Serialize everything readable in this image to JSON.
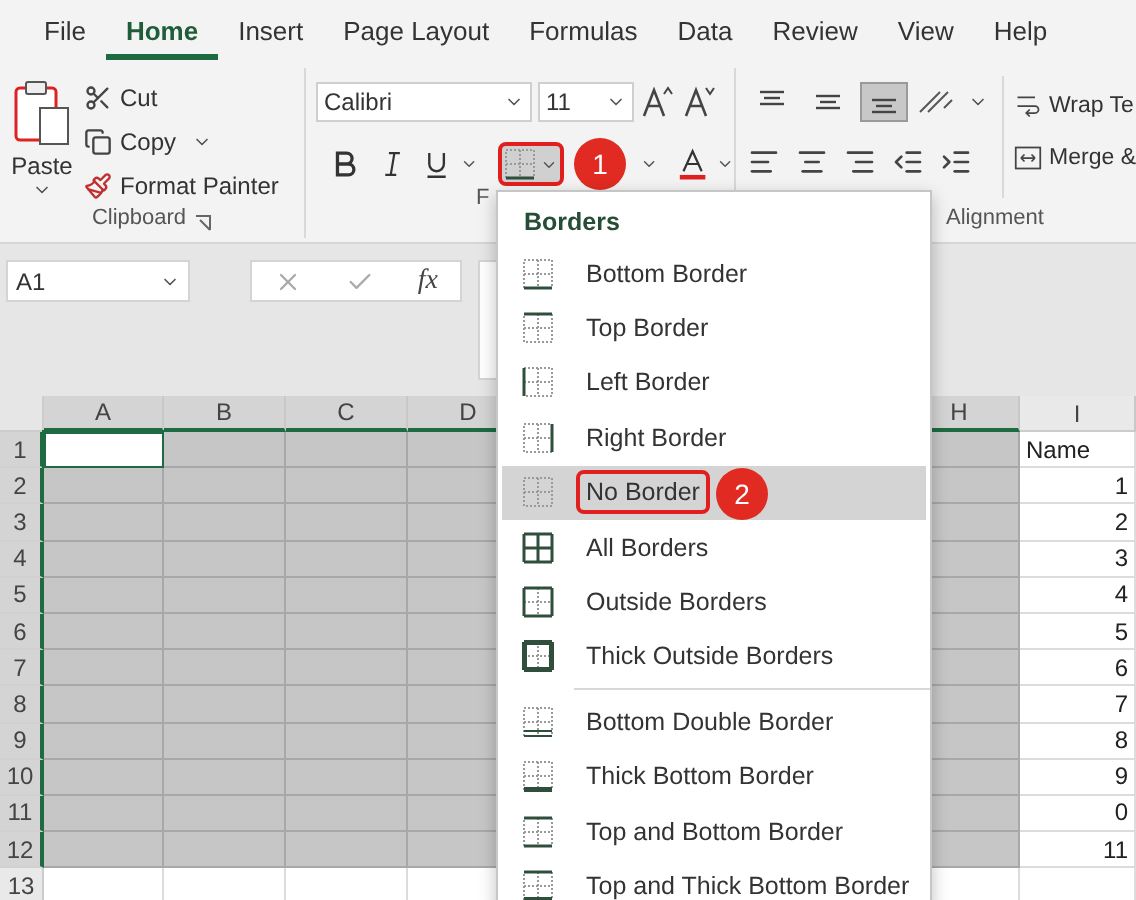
{
  "ribbon_tabs": [
    {
      "label": "File",
      "selected": false
    },
    {
      "label": "Home",
      "selected": true
    },
    {
      "label": "Insert",
      "selected": false
    },
    {
      "label": "Page Layout",
      "selected": false
    },
    {
      "label": "Formulas",
      "selected": false
    },
    {
      "label": "Data",
      "selected": false
    },
    {
      "label": "Review",
      "selected": false
    },
    {
      "label": "View",
      "selected": false
    },
    {
      "label": "Help",
      "selected": false
    }
  ],
  "clipboard": {
    "paste": "Paste",
    "group_label": "Clipboard",
    "commands": [
      {
        "kind": "cut",
        "label": "Cut"
      },
      {
        "kind": "copy",
        "label": "Copy"
      },
      {
        "kind": "format_painter",
        "label": "Format Painter"
      }
    ]
  },
  "font": {
    "font_name": "Calibri",
    "font_size": "11",
    "group_label": "F",
    "borders_button": {
      "outlined": true,
      "callout": "1"
    }
  },
  "alignment": {
    "group_label": "Alignment",
    "wrap_text": "Wrap Te",
    "merge": "Merge &",
    "vertical": [
      {
        "kind": "top",
        "selected": false
      },
      {
        "kind": "middle",
        "selected": false
      },
      {
        "kind": "bottom",
        "selected": true
      }
    ]
  },
  "formula_bar": {
    "name_box": "A1",
    "function_symbol": "fx"
  },
  "sheet": {
    "columns": [
      {
        "label": "A",
        "selected": true
      },
      {
        "label": "B",
        "selected": true
      },
      {
        "label": "C",
        "selected": true
      },
      {
        "label": "D",
        "selected": true
      },
      {
        "label": "H",
        "selected": true
      },
      {
        "label": "I",
        "selected": false
      }
    ],
    "rows": [
      {
        "header": "1",
        "selected": true,
        "active_cell": true,
        "column_i": {
          "text": "Name",
          "kind": "text"
        }
      },
      {
        "header": "2",
        "selected": true,
        "active_cell": false,
        "column_i": {
          "text": "1",
          "kind": "number"
        }
      },
      {
        "header": "3",
        "selected": true,
        "active_cell": false,
        "column_i": {
          "text": "2",
          "kind": "number"
        }
      },
      {
        "header": "4",
        "selected": true,
        "active_cell": false,
        "column_i": {
          "text": "3",
          "kind": "number"
        }
      },
      {
        "header": "5",
        "selected": true,
        "active_cell": false,
        "column_i": {
          "text": "4",
          "kind": "number"
        }
      },
      {
        "header": "6",
        "selected": true,
        "active_cell": false,
        "column_i": {
          "text": "5",
          "kind": "number"
        }
      },
      {
        "header": "7",
        "selected": true,
        "active_cell": false,
        "column_i": {
          "text": "6",
          "kind": "number"
        }
      },
      {
        "header": "8",
        "selected": true,
        "active_cell": false,
        "column_i": {
          "text": "7",
          "kind": "number"
        }
      },
      {
        "header": "9",
        "selected": true,
        "active_cell": false,
        "column_i": {
          "text": "8",
          "kind": "number"
        }
      },
      {
        "header": "10",
        "selected": true,
        "active_cell": false,
        "column_i": {
          "text": "9",
          "kind": "number"
        }
      },
      {
        "header": "11",
        "selected": true,
        "active_cell": false,
        "column_i": {
          "text": "0",
          "kind": "number"
        }
      },
      {
        "header": "12",
        "selected": true,
        "active_cell": false,
        "column_i": {
          "text": "11",
          "kind": "number"
        }
      },
      {
        "header": "13",
        "selected": false,
        "active_cell": false
      }
    ]
  },
  "borders_menu": {
    "title": "Borders",
    "sections": [
      {
        "items": [
          {
            "kind": "bottom",
            "label": "Bottom Border",
            "selected": false
          },
          {
            "kind": "top",
            "label": "Top Border",
            "selected": false
          },
          {
            "kind": "left",
            "label": "Left Border",
            "selected": false
          },
          {
            "kind": "right",
            "label": "Right Border",
            "selected": false
          },
          {
            "kind": "none",
            "label": "No Border",
            "selected": true,
            "outlined": true,
            "callout": "2"
          },
          {
            "kind": "all",
            "label": "All Borders",
            "selected": false
          },
          {
            "kind": "outside",
            "label": "Outside Borders",
            "selected": false
          },
          {
            "kind": "thick_outside",
            "label": "Thick Outside Borders",
            "selected": false
          }
        ]
      },
      {
        "items": [
          {
            "kind": "bottom_double",
            "label": "Bottom Double Border",
            "selected": false
          },
          {
            "kind": "thick_bottom",
            "label": "Thick Bottom Border",
            "selected": false
          },
          {
            "kind": "top_bottom",
            "label": "Top and Bottom Border",
            "selected": false
          },
          {
            "kind": "top_thick_bottom",
            "label": "Top and Thick Bottom Border",
            "selected": false
          }
        ]
      }
    ]
  }
}
